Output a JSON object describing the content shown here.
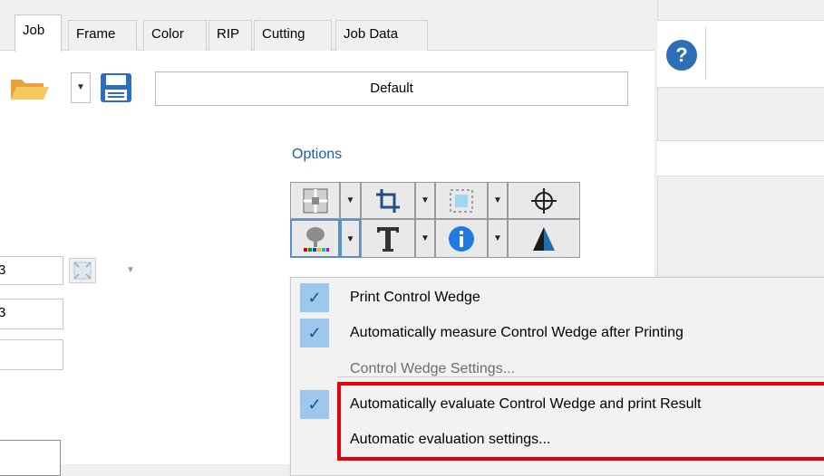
{
  "tabs": [
    {
      "label": "Job",
      "active": true
    },
    {
      "label": "Frame",
      "active": false
    },
    {
      "label": "Color",
      "active": false
    },
    {
      "label": "RIP",
      "active": false
    },
    {
      "label": "Cutting",
      "active": false
    },
    {
      "label": "Job Data",
      "active": false
    }
  ],
  "toolbar": {
    "open_icon": "folder-open-icon",
    "save_icon": "floppy-save-icon",
    "preset_value": "Default"
  },
  "options": {
    "label": "Options",
    "row1": [
      "tile-icon",
      "crop-icon",
      "bounding-box-icon",
      "crosshair-icon"
    ],
    "row2": [
      "control-wedge-icon",
      "text-icon",
      "info-icon",
      "trim-mark-icon"
    ]
  },
  "form": {
    "field1_value": "3",
    "field2_value": "3",
    "field3_value": ""
  },
  "help_icon": "?",
  "menu": {
    "items": [
      {
        "label": "Print Control Wedge",
        "checked": true,
        "enabled": true
      },
      {
        "label": "Automatically measure Control Wedge after Printing",
        "checked": true,
        "enabled": true
      },
      {
        "label": "Control Wedge Settings...",
        "checked": false,
        "enabled": false
      },
      {
        "label": "Automatically evaluate Control Wedge and print Result",
        "checked": true,
        "enabled": true
      },
      {
        "label": "Automatic evaluation settings...",
        "checked": false,
        "enabled": true
      }
    ],
    "check_glyph": "✓"
  },
  "colors": {
    "accent": "#1e5ea8",
    "highlight_border": "#e8000b",
    "check_bg": "#9dc8ee"
  }
}
